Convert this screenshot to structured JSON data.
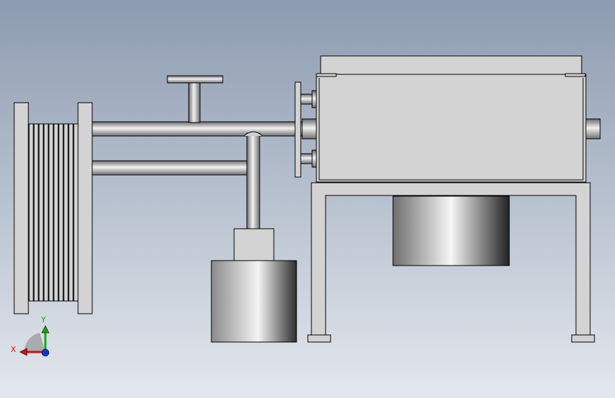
{
  "viewport": {
    "background_top": "#8c9bb0",
    "background_bottom": "#e4e8ee"
  },
  "colors": {
    "part_fill": "#d3d3d3",
    "part_stroke": "#000000",
    "pipe_dark": "#6a6a6a",
    "pipe_light": "#f2f2f2",
    "cylinder_dark": "#3a3a3a",
    "cylinder_light": "#f4f4f4"
  },
  "triad": {
    "x_label": "X",
    "y_label": "Y",
    "x_color": "#cc1111",
    "y_color": "#11aa11",
    "z_color": "#1133dd"
  }
}
